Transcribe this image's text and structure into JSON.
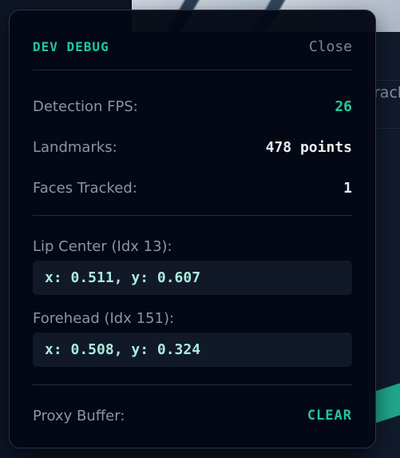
{
  "background": {
    "partial_text": "rack"
  },
  "panel": {
    "title": "DEV DEBUG",
    "close_label": "Close",
    "stats": {
      "fps_label": "Detection FPS:",
      "fps_value": "26",
      "landmarks_label": "Landmarks:",
      "landmarks_value": "478 points",
      "faces_label": "Faces Tracked:",
      "faces_value": "1"
    },
    "lip": {
      "label": "Lip Center (Idx 13):",
      "coords": "x: 0.511, y: 0.607"
    },
    "forehead": {
      "label": "Forehead (Idx 151):",
      "coords": "x: 0.508, y: 0.324"
    },
    "proxy": {
      "label": "Proxy Buffer:",
      "clear_label": "CLEAR"
    }
  },
  "colors": {
    "accent": "#22c5a4",
    "fps_value": "#27c79a",
    "coord_text": "#a8ecdc",
    "panel_bg": "#030814",
    "label": "#8b95a5"
  }
}
